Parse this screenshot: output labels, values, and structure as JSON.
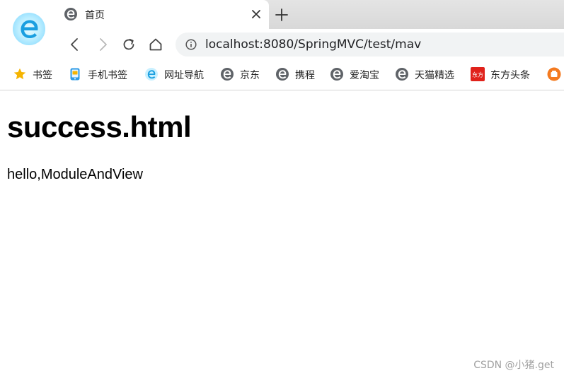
{
  "browser": {
    "tab": {
      "title": "首页"
    },
    "address": {
      "url": "localhost:8080/SpringMVC/test/mav"
    },
    "bookmarks": [
      {
        "label": "书签",
        "icon": "star-icon"
      },
      {
        "label": "手机书签",
        "icon": "phone-icon"
      },
      {
        "label": "网址导航",
        "icon": "browser-logo-icon"
      },
      {
        "label": "京东",
        "icon": "e-icon"
      },
      {
        "label": "携程",
        "icon": "e-icon"
      },
      {
        "label": "爱淘宝",
        "icon": "e-icon"
      },
      {
        "label": "天猫精选",
        "icon": "e-icon"
      },
      {
        "label": "东方头条",
        "icon": "dongfang-icon",
        "icon_text": "东方"
      }
    ]
  },
  "page": {
    "heading": "success.html",
    "body_text": "hello,ModuleAndView"
  },
  "watermark": "CSDN @小猪.get",
  "colors": {
    "accent_blue": "#1a9fe0",
    "tabstrip": "#dcdcdc",
    "addressbar": "#f1f3f4",
    "star": "#f5b400",
    "dongfang_red": "#e0221b",
    "orange": "#f47a20"
  }
}
